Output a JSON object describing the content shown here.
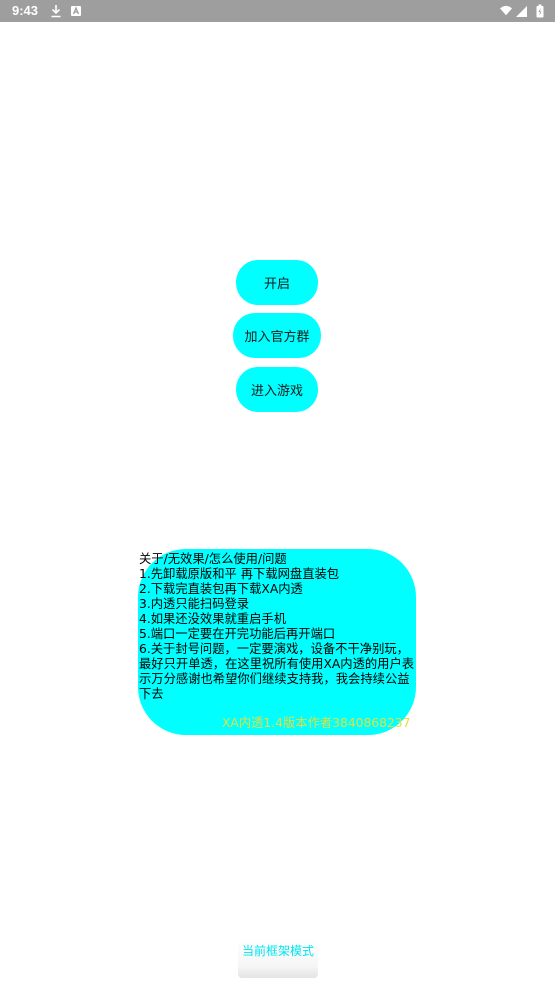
{
  "status_bar": {
    "time": "9:43",
    "icons": [
      "download-icon",
      "a-icon",
      "wifi-icon",
      "signal-icon",
      "battery-icon"
    ]
  },
  "buttons": {
    "start_label": "开启",
    "join_group_label": "加入官方群",
    "enter_game_label": "进入游戏"
  },
  "info_card": {
    "lines": [
      "关于/无效果/怎么使用/问题",
      "1.先卸载原版和平 再下载网盘直装包",
      "2.下载完直装包再下载XA内透",
      "3.内透只能扫码登录",
      "4.如果还没效果就重启手机",
      "5.端口一定要在开完功能后再开端口"
    ],
    "paragraph": "6.关于封号问题，一定要演戏，设备不干净别玩，最好只开单透，在这里祝所有使用XA内透的用户表示万分感谢也希望你们继续支持我，我会持续公益下去",
    "author": "XA内透1.4版本作者3840868237"
  },
  "footer": {
    "mode_label": "当前框架模式"
  },
  "colors": {
    "accent": "#00ffff",
    "author_text": "#e0e040",
    "mode_label": "#00e5f0",
    "status_bar": "#9e9e9e"
  }
}
